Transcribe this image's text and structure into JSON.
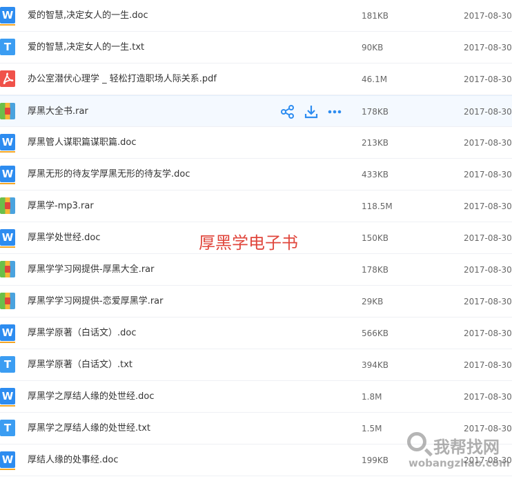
{
  "files": [
    {
      "name": "爱的智慧,决定女人的一生.doc",
      "size": "181KB",
      "date": "2017-08-30",
      "type": "doc"
    },
    {
      "name": "爱的智慧,决定女人的一生.txt",
      "size": "90KB",
      "date": "2017-08-30",
      "type": "txt"
    },
    {
      "name": "办公室潜伏心理学 _ 轻松打造职场人际关系.pdf",
      "size": "46.1M",
      "date": "2017-08-30",
      "type": "pdf"
    },
    {
      "name": "厚黑大全书.rar",
      "size": "178KB",
      "date": "2017-08-30",
      "type": "rar",
      "hover": true
    },
    {
      "name": "厚黑管人谋职篇谋职篇.doc",
      "size": "213KB",
      "date": "2017-08-30",
      "type": "doc"
    },
    {
      "name": "厚黑无形的待友学厚黑无形的待友学.doc",
      "size": "433KB",
      "date": "2017-08-30",
      "type": "doc"
    },
    {
      "name": "厚黑学-mp3.rar",
      "size": "118.5M",
      "date": "2017-08-30",
      "type": "rar"
    },
    {
      "name": "厚黑学处世经.doc",
      "size": "150KB",
      "date": "2017-08-30",
      "type": "doc"
    },
    {
      "name": "厚黑学学习网提供-厚黑大全.rar",
      "size": "178KB",
      "date": "2017-08-30",
      "type": "rar"
    },
    {
      "name": "厚黑学学习网提供-恋爱厚黑学.rar",
      "size": "29KB",
      "date": "2017-08-30",
      "type": "rar"
    },
    {
      "name": "厚黑学原著（白话文）.doc",
      "size": "566KB",
      "date": "2017-08-30",
      "type": "doc"
    },
    {
      "name": "厚黑学原著（白话文）.txt",
      "size": "394KB",
      "date": "2017-08-30",
      "type": "txt"
    },
    {
      "name": "厚黑学之厚结人缘的处世经.doc",
      "size": "1.8M",
      "date": "2017-08-30",
      "type": "doc"
    },
    {
      "name": "厚黑学之厚结人缘的处世经.txt",
      "size": "1.5M",
      "date": "2017-08-30",
      "type": "txt"
    },
    {
      "name": "厚结人缘的处事经.doc",
      "size": "199KB",
      "date": "2017-08-30",
      "type": "doc"
    }
  ],
  "icon_glyphs": {
    "doc": "W",
    "txt": "T",
    "pdf": "",
    "rar": ""
  },
  "icon_names": {
    "doc": "word-doc-icon",
    "txt": "text-file-icon",
    "pdf": "pdf-icon",
    "rar": "archive-icon"
  },
  "row_actions": [
    "share-icon",
    "download-icon",
    "more-icon"
  ],
  "overlay_title": "厚黑学电子书",
  "watermark_logo": {
    "cn": "我帮找网",
    "en": "wobangzhao.com"
  },
  "colors": {
    "accent": "#2d8cf0",
    "title_red": "#e0463c",
    "pdf_red": "#f0524a"
  }
}
